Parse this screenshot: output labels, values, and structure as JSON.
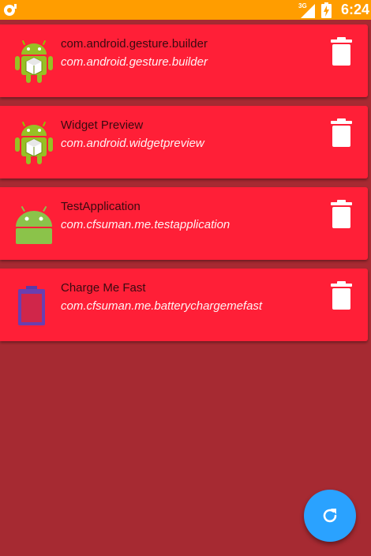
{
  "status_bar": {
    "time": "6:24",
    "network": "3G",
    "background_color": "#ff9d00"
  },
  "theme": {
    "background": "#a62a32",
    "card_color": "#ff1f37",
    "fab_color": "#2aa2ff"
  },
  "apps": [
    {
      "name": "com.android.gesture.builder",
      "package": "com.android.gesture.builder",
      "icon": "android-package-icon"
    },
    {
      "name": "Widget Preview",
      "package": "com.android.widgetpreview",
      "icon": "android-package-icon"
    },
    {
      "name": "TestApplication",
      "package": "com.cfsuman.me.testapplication",
      "icon": "android-default-icon"
    },
    {
      "name": "Charge Me Fast",
      "package": "com.cfsuman.me.batterychargemefast",
      "icon": "battery-app-icon"
    }
  ],
  "actions": {
    "delete_icon": "trash-icon",
    "refresh_icon": "refresh-icon"
  }
}
